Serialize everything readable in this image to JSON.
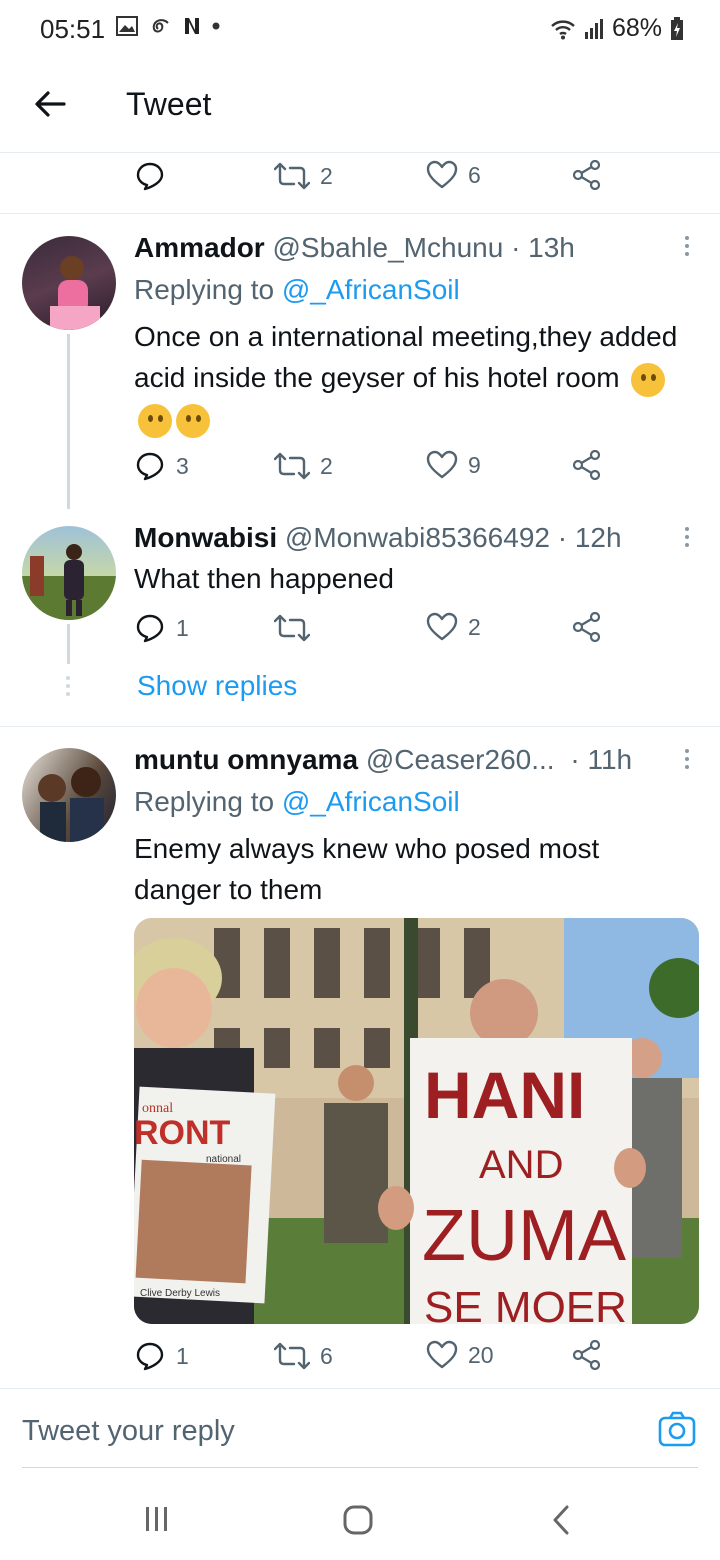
{
  "status_bar": {
    "time": "05:51",
    "battery": "68%"
  },
  "app_bar": {
    "title": "Tweet"
  },
  "top_actions": {
    "retweets": "2",
    "likes": "6"
  },
  "tweets": [
    {
      "display_name": "Ammador",
      "handle": "@Sbahle_Mchunu",
      "time": "· 13h",
      "replying_label": "Replying to",
      "replying_to": "@_AfricanSoil",
      "text": "Once on a international meeting,they added acid inside the geyser of his hotel room",
      "replies": "3",
      "retweets": "2",
      "likes": "9"
    },
    {
      "display_name": "Monwabisi",
      "handle": "@Monwabi85366492",
      "time": "· 12h",
      "text": "What then happened",
      "replies": "1",
      "retweets": "",
      "likes": "2",
      "show_replies": "Show replies"
    },
    {
      "display_name": "muntu omnyama",
      "handle": "@Ceaser260...",
      "time": "· 11h",
      "replying_label": "Replying to",
      "replying_to": "@_AfricanSoil",
      "text": "Enemy always knew who posed most danger to them",
      "replies": "1",
      "retweets": "6",
      "likes": "20",
      "image_sign": {
        "line1": "HANI",
        "line2": "AND",
        "line3": "ZUMA",
        "line4": "SE MOER"
      },
      "image_poster": {
        "text": "RONT",
        "small": "onnal",
        "small2": "national",
        "caption": "Clive Derby Lewis"
      }
    }
  ],
  "reply_bar": {
    "placeholder": "Tweet your reply"
  }
}
